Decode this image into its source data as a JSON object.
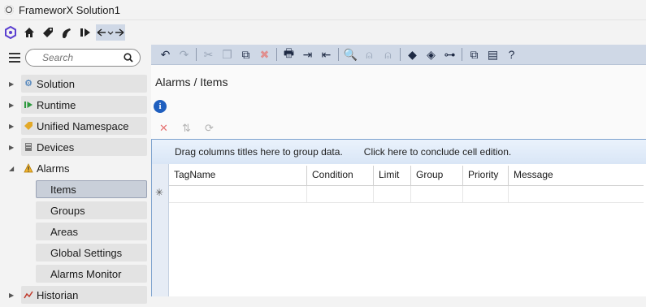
{
  "window": {
    "title": "FrameworX Solution1"
  },
  "search": {
    "placeholder": "Search"
  },
  "tree": {
    "nodes": [
      {
        "label": "Solution",
        "icon": "gear-icon"
      },
      {
        "label": "Runtime",
        "icon": "runtime-icon"
      },
      {
        "label": "Unified Namespace",
        "icon": "tag-icon"
      },
      {
        "label": "Devices",
        "icon": "device-icon"
      },
      {
        "label": "Alarms",
        "icon": "warning-icon"
      }
    ],
    "alarm_children": [
      "Items",
      "Groups",
      "Areas",
      "Global Settings",
      "Alarms Monitor"
    ],
    "next_node": "Historian"
  },
  "content": {
    "breadcrumb": "Alarms / Items",
    "group_hint": "Drag columns titles here to group data.",
    "edit_hint": "Click here to conclude cell edition.",
    "new_row_marker": "✳",
    "columns": [
      "TagName",
      "Condition",
      "Limit",
      "Group",
      "Priority",
      "Message"
    ]
  },
  "colors": {
    "toolbar": "#cfd8e6",
    "accent": "#1f5fbf",
    "selected": "#c9cfd9"
  }
}
